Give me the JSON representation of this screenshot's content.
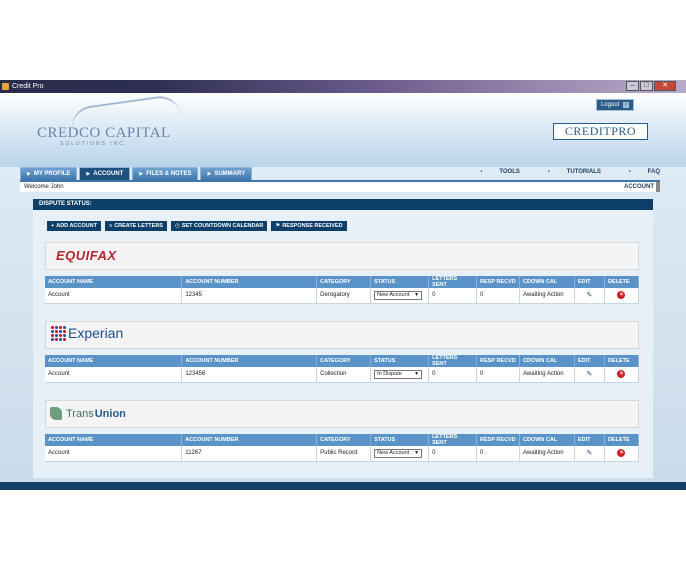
{
  "window": {
    "title": "Credit Pro",
    "min": "–",
    "max": "□",
    "close": "✕"
  },
  "header": {
    "company_logo": "CREDCO CAPITAL",
    "company_sub": "SOLUTIONS INC.",
    "logout_label": "Logout",
    "product_logo": "CREDITPRO"
  },
  "tabs": [
    {
      "label": "MY PROFILE"
    },
    {
      "label": "ACCOUNT"
    },
    {
      "label": "FILES & NOTES"
    },
    {
      "label": "SUMMARY"
    }
  ],
  "toplinks": [
    "TOOLS",
    "TUTORIALS",
    "FAQ"
  ],
  "welcome": {
    "text": "Welcome John",
    "crumb": "ACCOUNT"
  },
  "panel": {
    "title": "DISPUTE STATUS:"
  },
  "actions": [
    {
      "icon": "+",
      "label": "ADD ACCOUNT"
    },
    {
      "icon": "≡",
      "label": "CREATE LETTERS"
    },
    {
      "icon": "◷",
      "label": "SET COUNTDOWN CALENDAR"
    },
    {
      "icon": "⚑",
      "label": "RESPONSE RECEIVED"
    }
  ],
  "columns": [
    "ACCOUNT NAME",
    "ACCOUNT NUMBER",
    "CATEGORY",
    "STATUS",
    "LETTERS SENT",
    "RESP RECVD",
    "CDOWN CAL",
    "EDIT",
    "DELETE"
  ],
  "bureaus": [
    {
      "logo": "EQUIFAX",
      "row": {
        "name": "Account",
        "number": "12345",
        "category": "Derogatory",
        "status": "New Account",
        "letters": "0",
        "resp": "0",
        "cdown": "Awaiting Action"
      }
    },
    {
      "logo": "Experian",
      "row": {
        "name": "Account",
        "number": "123456",
        "category": "Collection",
        "status": "In Dispute",
        "letters": "0",
        "resp": "0",
        "cdown": "Awaiting Action"
      }
    },
    {
      "logo_a": "Trans",
      "logo_b": "Union",
      "row": {
        "name": "Account",
        "number": "11267",
        "category": "Public Record",
        "status": "New Account",
        "letters": "0",
        "resp": "0",
        "cdown": "Awaiting Action"
      }
    }
  ],
  "icons": {
    "edit": "pencil-icon",
    "delete": "delete-icon",
    "dropdown": "chevron-down-icon"
  },
  "colors": {
    "nav": "#3f77ad",
    "dark": "#0e3f68",
    "header_row": "#5a93c8",
    "delete": "#d21f1f"
  }
}
